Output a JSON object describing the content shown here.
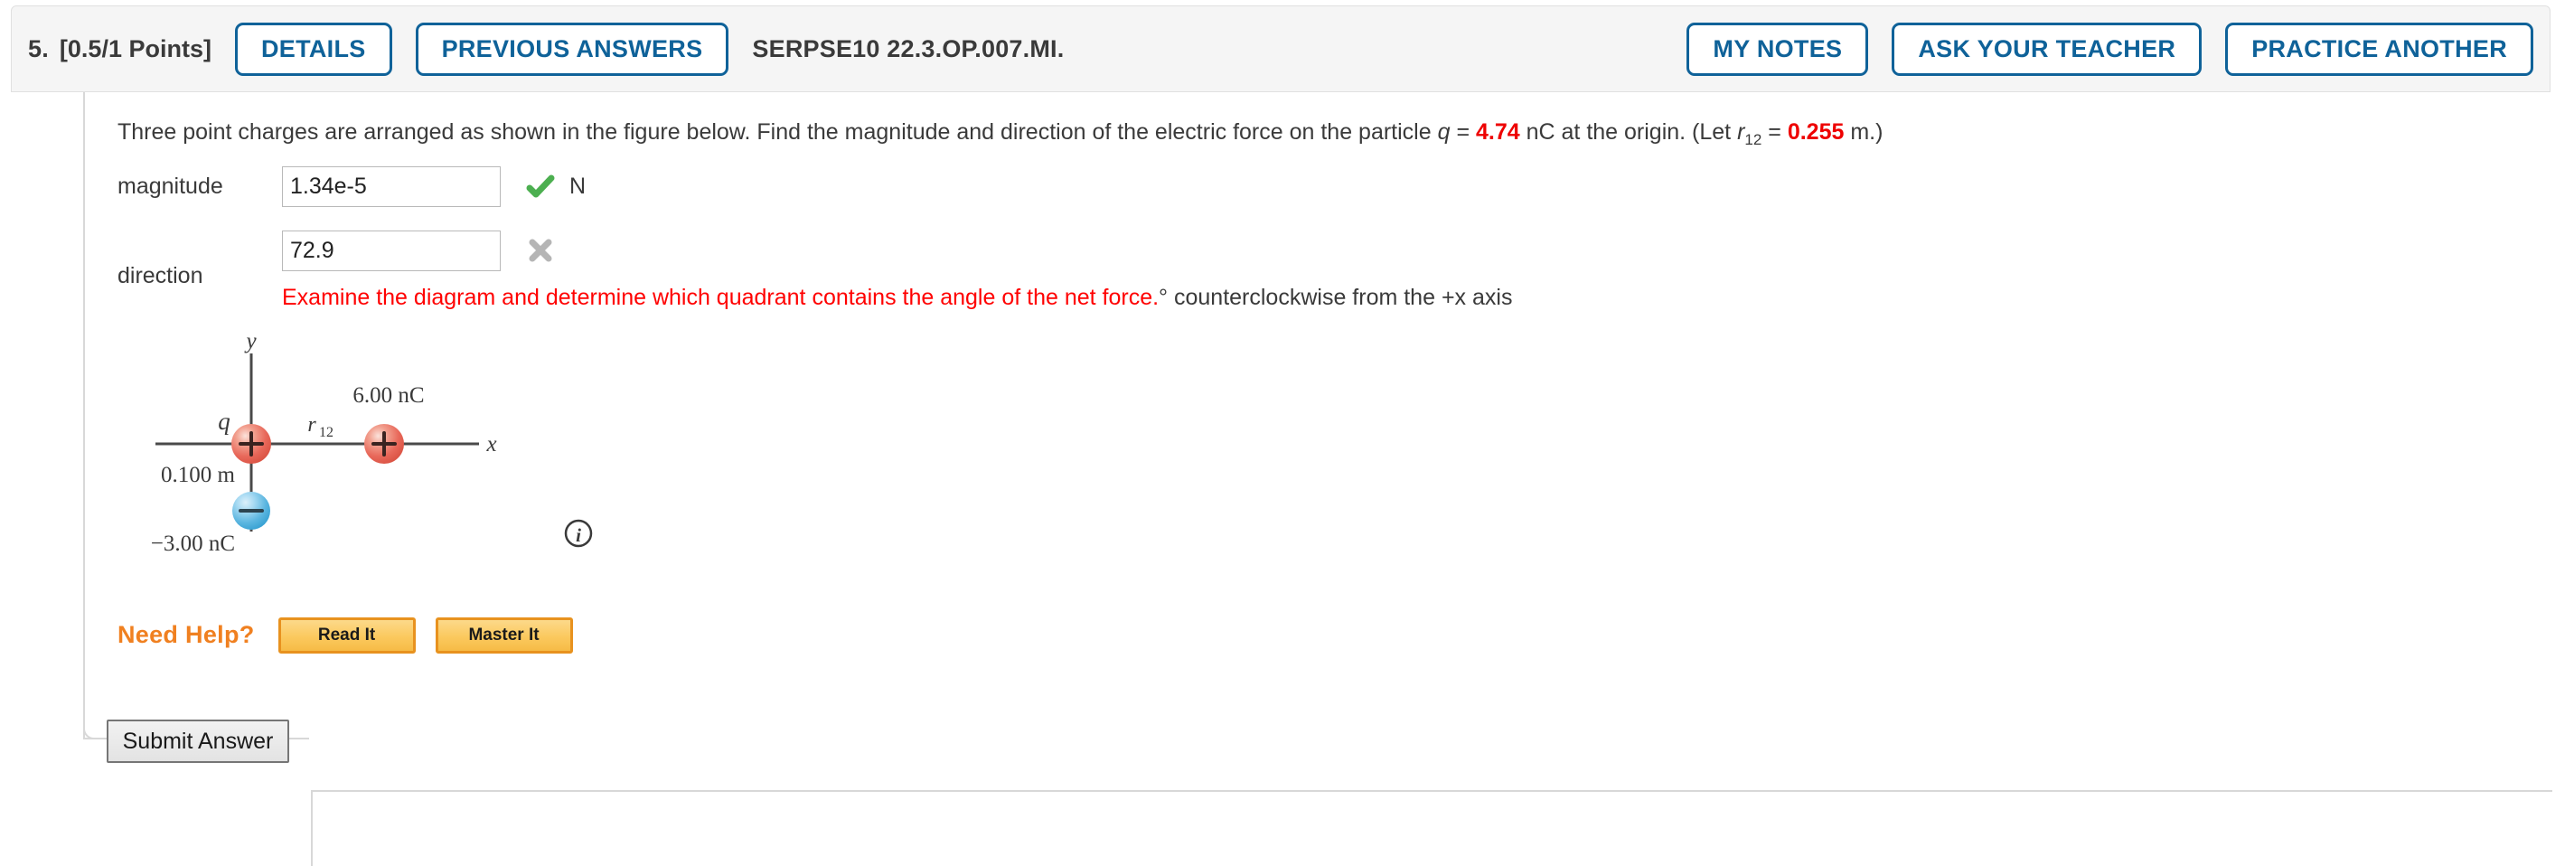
{
  "header": {
    "question_number": "5.",
    "points": "[0.5/1 Points]",
    "details_label": "DETAILS",
    "previous_answers_label": "PREVIOUS ANSWERS",
    "question_code": "SERPSE10 22.3.OP.007.MI.",
    "my_notes_label": "MY NOTES",
    "ask_your_teacher_label": "ASK YOUR TEACHER",
    "practice_another_label": "PRACTICE ANOTHER",
    "accent_color": "#0f6299"
  },
  "prompt": {
    "part1": "Three point charges are arranged as shown in the figure below. Find the magnitude and direction of the electric force on the particle ",
    "q_symbol": "q",
    "eq1": " = ",
    "q_value": "4.74",
    "part2": " nC at the origin. (Let ",
    "r_symbol": "r",
    "r_subscript": "12",
    "eq2": " = ",
    "r_value": "0.255",
    "part3": " m.)"
  },
  "answers": {
    "magnitude": {
      "label": "magnitude",
      "value": "1.34e-5",
      "placeholder": "",
      "status": "correct",
      "unit": "N"
    },
    "direction": {
      "label": "direction",
      "value": "72.9",
      "placeholder": "",
      "status": "incorrect",
      "feedback_red": "Examine the diagram and determine which quadrant contains the angle of the net force.",
      "feedback_gray": "° counterclockwise from the +x axis"
    }
  },
  "figure": {
    "y_axis_label": "y",
    "x_axis_label": "x",
    "charge_q_label": "q",
    "r12_label": "r",
    "r12_subscript": "12",
    "charge_right_label": "6.00 nC",
    "distance_label": "0.100 m",
    "charge_bottom_label": "−3.00 nC",
    "positive_sign": "+",
    "negative_sign": "−",
    "info_icon_label": "i",
    "positive_color": "#e8685a",
    "negative_color": "#5cb6e0"
  },
  "need_help": {
    "label": "Need Help?",
    "read_it_label": "Read It",
    "master_it_label": "Master It",
    "accent_color": "#f08020"
  },
  "submit": {
    "label": "Submit Answer"
  }
}
